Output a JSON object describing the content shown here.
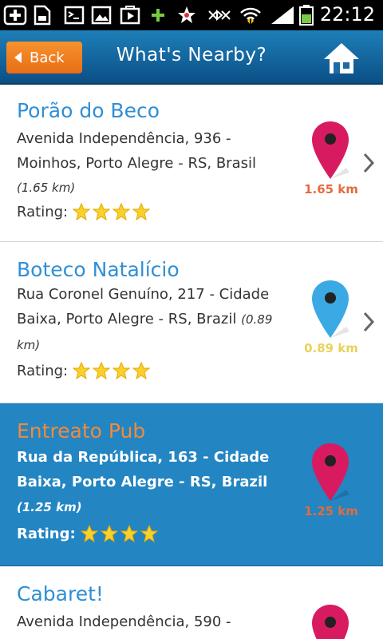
{
  "status_bar": {
    "time": "22:12"
  },
  "header": {
    "back_label": "Back",
    "title": "What's Nearby?"
  },
  "places": [
    {
      "name": "Porão do Beco",
      "address_line1": "Avenida Independência, 936 -",
      "address_line2": "Moinhos, Porto Alegre - RS, Brasil",
      "distance_inline": "(1.65 km)",
      "rating_label": "Rating:",
      "stars": 4,
      "distance": "1.65 km",
      "pin_color": "#d81b60",
      "distance_color": "#e36b3f"
    },
    {
      "name": "Boteco Natalício",
      "address_line1": "Rua Coronel Genuíno, 217 - Cidade",
      "address_line2": "Baixa, Porto Alegre - RS, Brazil",
      "distance_inline": "(0.89 km)",
      "rating_label": "Rating:",
      "stars": 4,
      "distance": "0.89 km",
      "pin_color": "#3aa9e4",
      "distance_color": "#e8d25a"
    },
    {
      "name": "Entreato Pub",
      "address_line1": "Rua da República, 163 - Cidade",
      "address_line2": "Baixa, Porto Alegre - RS, Brazil",
      "distance_inline": "(1.25 km)",
      "rating_label": "Rating:",
      "stars": 4,
      "distance": "1.25 km",
      "pin_color": "#d81b60",
      "distance_color": "#e36b3f"
    },
    {
      "name": "Cabaret!",
      "address_line1": "Avenida Independência, 590 -",
      "pin_color": "#d81b60"
    }
  ]
}
